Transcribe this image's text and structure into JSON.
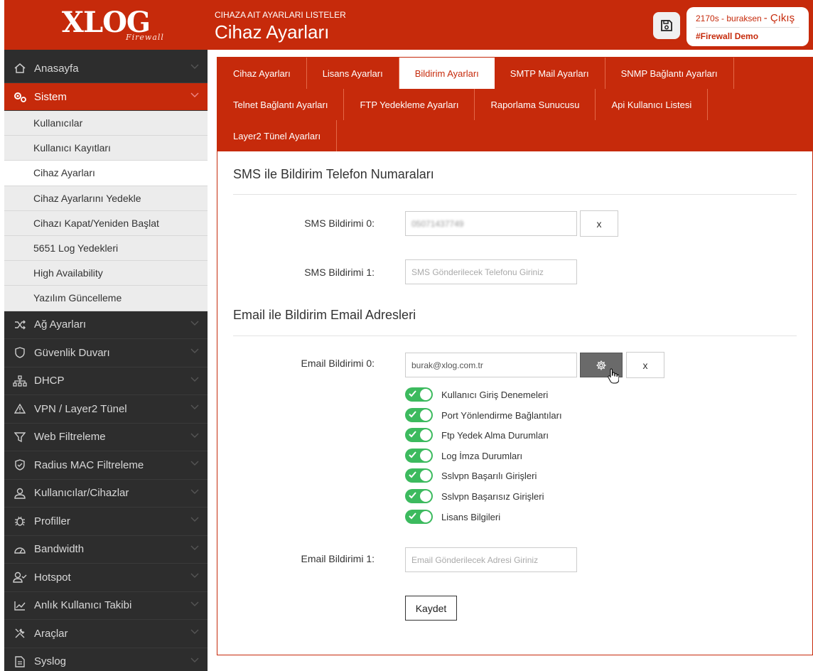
{
  "logo": {
    "text": "XLOG",
    "sub": "Firewall"
  },
  "header": {
    "subtitle": "CIHAZA AIT AYARLARI LISTELER",
    "title": "Cihaz Ayarları"
  },
  "user": {
    "name": "2170s - buraksen",
    "logout": "- Çıkış",
    "demo": "#Firewall Demo"
  },
  "sidebar": {
    "items": [
      {
        "label": "Anasayfa",
        "icon": "home-icon"
      },
      {
        "label": "Sistem",
        "icon": "gears-icon"
      },
      {
        "label": "Ağ Ayarları",
        "icon": "shuffle-icon"
      },
      {
        "label": "Güvenlik Duvarı",
        "icon": "shield-icon"
      },
      {
        "label": "DHCP",
        "icon": "sitemap-icon"
      },
      {
        "label": "VPN / Layer2 Tünel",
        "icon": "warning-icon"
      },
      {
        "label": "Web Filtreleme",
        "icon": "filter-icon"
      },
      {
        "label": "Radius MAC Filtreleme",
        "icon": "shield-check-icon"
      },
      {
        "label": "Kullanıcılar/Cihazlar",
        "icon": "user-icon"
      },
      {
        "label": "Profiller",
        "icon": "bug-icon"
      },
      {
        "label": "Bandwidth",
        "icon": "gauge-icon"
      },
      {
        "label": "Hotspot",
        "icon": "user-check-icon"
      },
      {
        "label": "Anlık Kullanıcı Takibi",
        "icon": "chart-line-icon"
      },
      {
        "label": "Araçlar",
        "icon": "tools-icon"
      },
      {
        "label": "Syslog",
        "icon": "file-icon"
      }
    ],
    "subitems": [
      "Kullanıcılar",
      "Kullanıcı Kayıtları",
      "Cihaz Ayarları",
      "Cihaz Ayarlarını Yedekle",
      "Cihazı Kapat/Yeniden Başlat",
      "5651 Log Yedekleri",
      "High Availability",
      "Yazılım Güncelleme"
    ]
  },
  "tabs": [
    "Cihaz Ayarları",
    "Lisans Ayarları",
    "Bildirim Ayarları",
    "SMTP Mail Ayarları",
    "SNMP Bağlantı Ayarları",
    "Telnet Bağlantı Ayarları",
    "FTP Yedekleme Ayarları",
    "Raporlama Sunucusu",
    "Api Kullanıcı Listesi",
    "Layer2 Tünel Ayarları"
  ],
  "sms": {
    "title": "SMS ile Bildirim Telefon Numaraları",
    "label0": "SMS Bildirimi 0:",
    "value0": "05071437749",
    "label1": "SMS Bildirimi 1:",
    "placeholder1": "SMS Gönderilecek Telefonu Giriniz",
    "remove": "x"
  },
  "email": {
    "title": "Email ile Bildirim Email Adresleri",
    "label0": "Email Bildirimi 0:",
    "value0": "burak@xlog.com.tr",
    "remove": "x",
    "options": [
      "Kullanıcı Giriş Denemeleri",
      "Port Yönlendirme Bağlantıları",
      "Ftp Yedek Alma Durumları",
      "Log İmza Durumları",
      "Sslvpn Başarılı Girişleri",
      "Sslvpn Başarısız Girişleri",
      "Lisans Bilgileri"
    ],
    "label1": "Email Bildirimi 1:",
    "placeholder1": "Email Gönderilecek Adresi Giriniz"
  },
  "save_label": "Kaydet"
}
